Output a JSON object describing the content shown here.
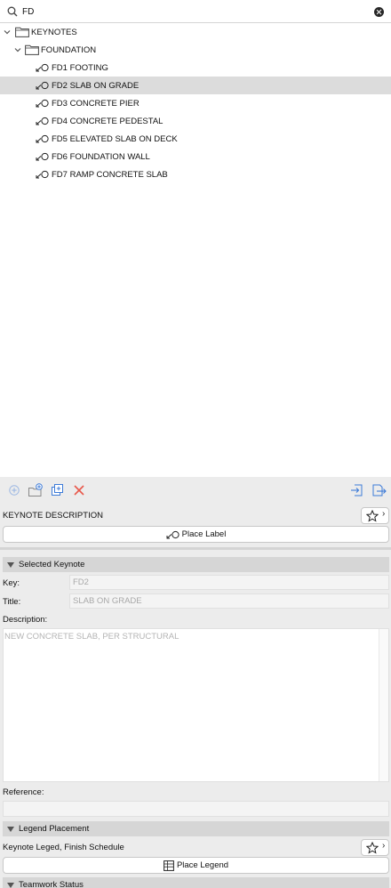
{
  "search": {
    "value": "FD",
    "placeholder": ""
  },
  "tree": {
    "root": "KEYNOTES",
    "folder": "FOUNDATION",
    "items": [
      {
        "label": "FD1 FOOTING",
        "selected": false
      },
      {
        "label": "FD2 SLAB ON GRADE",
        "selected": true
      },
      {
        "label": "FD3 CONCRETE PIER",
        "selected": false
      },
      {
        "label": "FD4 CONCRETE PEDESTAL",
        "selected": false
      },
      {
        "label": "FD5 ELEVATED SLAB ON DECK",
        "selected": false
      },
      {
        "label": "FD6 FOUNDATION WALL",
        "selected": false
      },
      {
        "label": "FD7 RAMP CONCRETE SLAB",
        "selected": false
      }
    ]
  },
  "toolbar": {
    "icons": [
      "add-keynote-icon",
      "new-folder-icon",
      "duplicate-icon",
      "delete-icon",
      "import-icon",
      "export-icon"
    ]
  },
  "keynote_description": {
    "title": "KEYNOTE DESCRIPTION",
    "place_label": "Place Label"
  },
  "selected_keynote": {
    "header": "Selected Keynote",
    "key_label": "Key:",
    "key_value": "FD2",
    "title_label": "Title:",
    "title_value": "SLAB ON GRADE",
    "description_label": "Description:",
    "description_value": "NEW CONCRETE SLAB, PER STRUCTURAL",
    "reference_label": "Reference:",
    "reference_value": ""
  },
  "legend_placement": {
    "header": "Legend Placement",
    "legend_name": "Keynote Leged, Finish Schedule",
    "place_legend": "Place Legend"
  },
  "teamwork": {
    "header": "Teamwork Status"
  },
  "colors": {
    "accent": "#3d7bd8",
    "delete": "#e8584a",
    "selected_row": "#dcdcdc"
  }
}
